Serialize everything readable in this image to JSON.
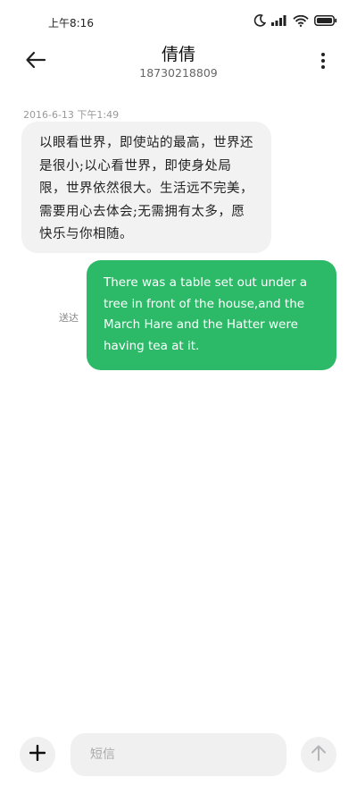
{
  "status_bar": {
    "time": "上午8:16",
    "icons": [
      "moon-icon",
      "signal-icon",
      "wifi-icon",
      "battery-icon"
    ]
  },
  "header": {
    "contact_name": "倩倩",
    "contact_number": "18730218809",
    "back_icon": "arrow-left-icon",
    "more_icon": "more-vertical-icon"
  },
  "messages": [
    {
      "direction": "incoming",
      "timestamp": "2016-6-13 下午1:49",
      "text": "以眼看世界，即使站的最高，世界还是很小;以心看世界，即使身处局限，世界依然很大。生活远不完美，需要用心去体会;无需拥有太多，愿快乐与你相随。"
    },
    {
      "direction": "outgoing",
      "status": "送达",
      "text": "There was a table set out under a tree in front of the house,and the March Hare and the Hatter were having tea at it."
    }
  ],
  "compose": {
    "placeholder": "短信",
    "value": "",
    "add_icon": "plus-icon",
    "send_icon": "arrow-up-icon"
  },
  "colors": {
    "outgoing_bubble": "#2dba68",
    "incoming_bubble": "#f2f2f3",
    "background": "#ffffff"
  }
}
